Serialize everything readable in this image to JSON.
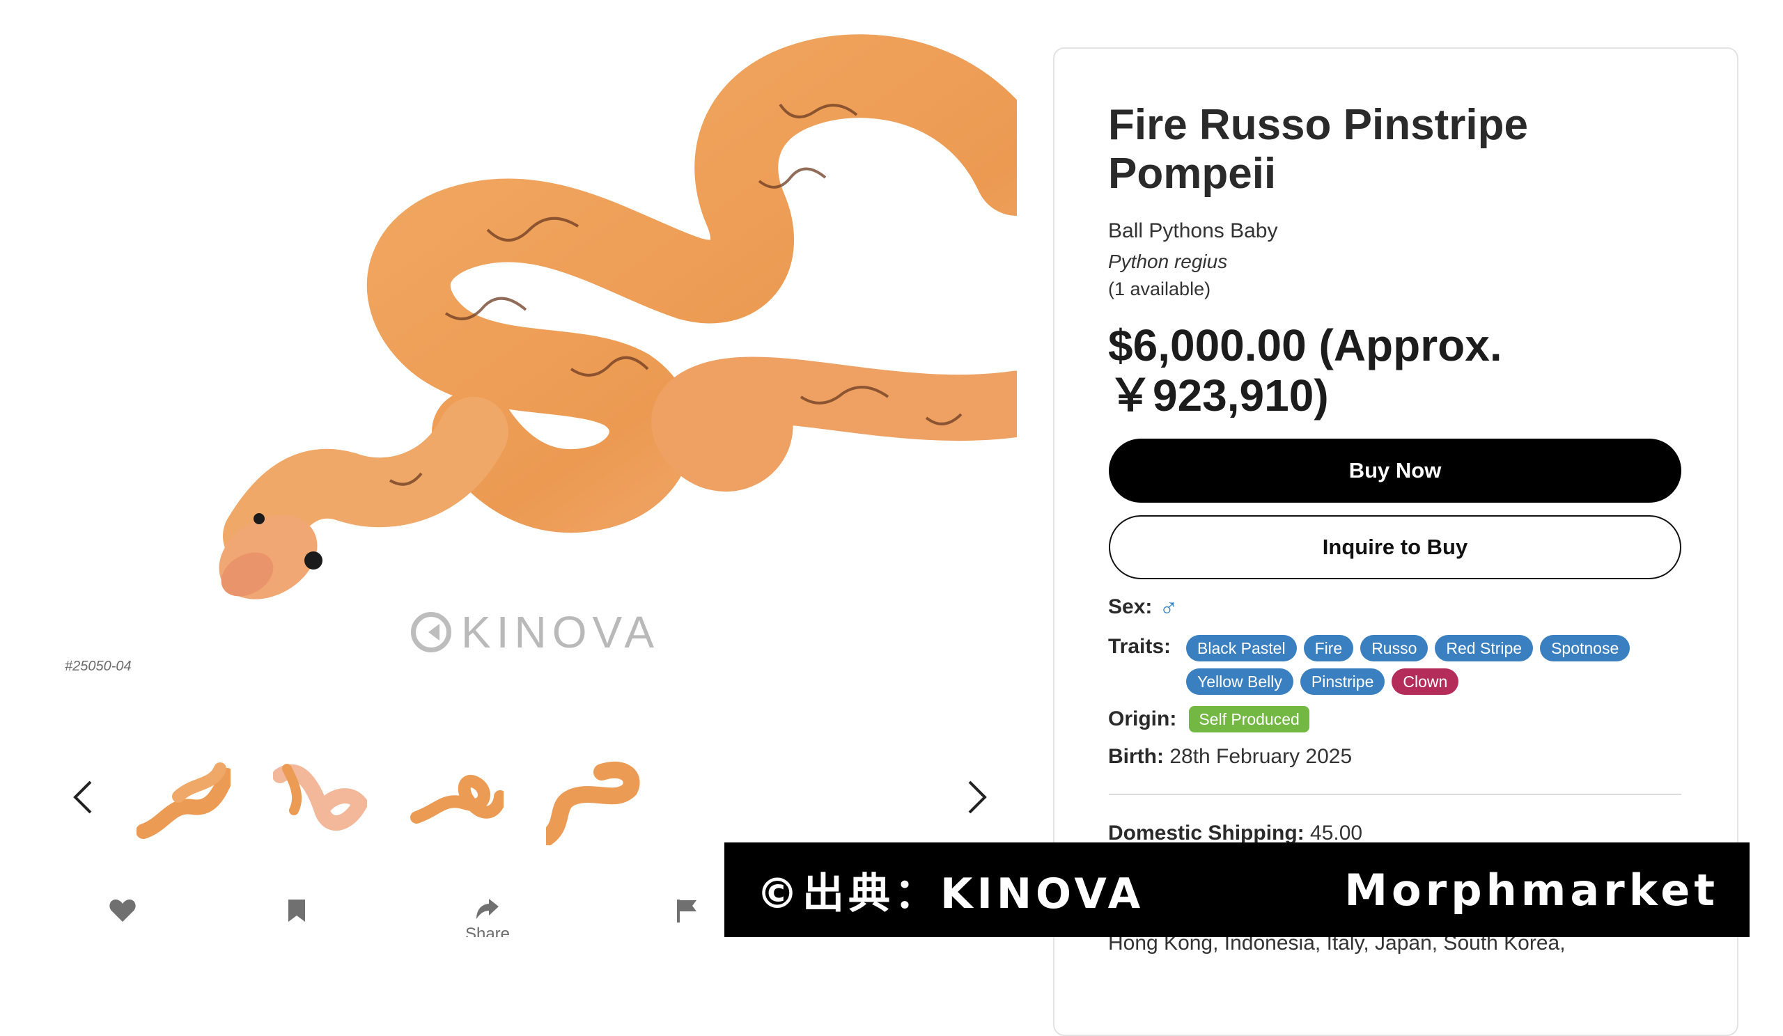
{
  "gallery": {
    "watermark_text": "KINOVA",
    "item_id": "#25050-04",
    "thumbnail_count": 4,
    "actions": [
      {
        "icon": "heart-icon",
        "label": ""
      },
      {
        "icon": "bookmark-icon",
        "label": ""
      },
      {
        "icon": "share-icon",
        "label": "Share"
      },
      {
        "icon": "flag-icon",
        "label": ""
      }
    ]
  },
  "product": {
    "title": "Fire Russo Pinstripe Pompeii",
    "category": "Ball Pythons Baby",
    "species": "Python regius",
    "availability": "(1 available)",
    "price": "$6,000.00 (Approx. ￥923,910)",
    "buy_label": "Buy Now",
    "inquire_label": "Inquire to Buy",
    "sex_label": "Sex:",
    "sex_symbol": "♂",
    "traits_label": "Traits:",
    "traits": [
      {
        "name": "Black Pastel",
        "kind": "dominant"
      },
      {
        "name": "Fire",
        "kind": "dominant"
      },
      {
        "name": "Russo",
        "kind": "dominant"
      },
      {
        "name": "Red Stripe",
        "kind": "dominant"
      },
      {
        "name": "Spotnose",
        "kind": "dominant"
      },
      {
        "name": "Yellow Belly",
        "kind": "dominant"
      },
      {
        "name": "Pinstripe",
        "kind": "dominant"
      },
      {
        "name": "Clown",
        "kind": "recessive"
      }
    ],
    "origin_label": "Origin:",
    "origin_value": "Self Produced",
    "birth_label": "Birth:",
    "birth_value": "28th February 2025",
    "shipping_label": "Domestic Shipping:",
    "shipping_value": "45.00",
    "countries_text": "Hong Kong, Indonesia, Italy, Japan, South Korea,"
  },
  "overlay": {
    "credit": "©出典：KINOVA",
    "site": "Morphmarket"
  },
  "colors": {
    "trait_chip": "#3a80c1",
    "recessive_chip": "#b42d5a",
    "origin_badge": "#72b842",
    "male_symbol": "#2f7fc6"
  }
}
